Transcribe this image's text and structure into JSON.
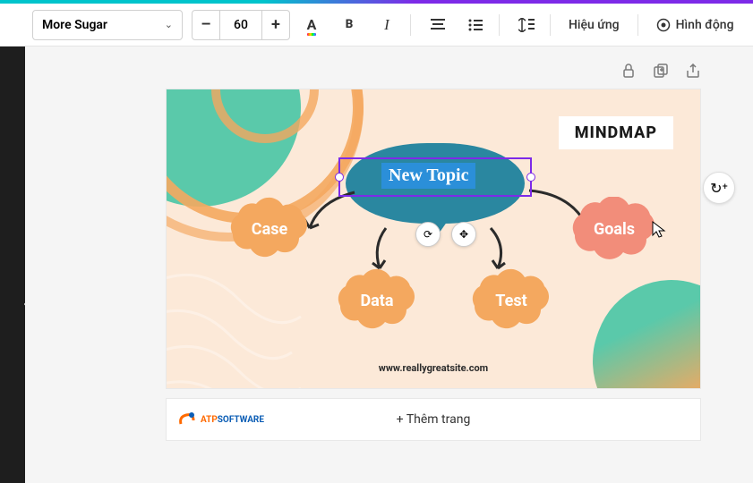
{
  "toolbar": {
    "font_name": "More Sugar",
    "font_size": "60",
    "decrease": "–",
    "increase": "+",
    "effects_label": "Hiệu ứng",
    "animate_label": "Hình động"
  },
  "slide": {
    "title": "MINDMAP",
    "bubble_text": "New Topic",
    "nodes": {
      "case": "Case",
      "data": "Data",
      "test": "Test",
      "goals": "Goals"
    },
    "url": "www.reallygreatsite.com"
  },
  "add_page_label": "+ Thêm trang",
  "logo": {
    "line1_a": "ATP",
    "line1_b": "SOFTWARE"
  },
  "colors": {
    "cloud_orange": "#f4a85f",
    "cloud_coral": "#f28d7a",
    "teal": "#5ac9aa"
  }
}
